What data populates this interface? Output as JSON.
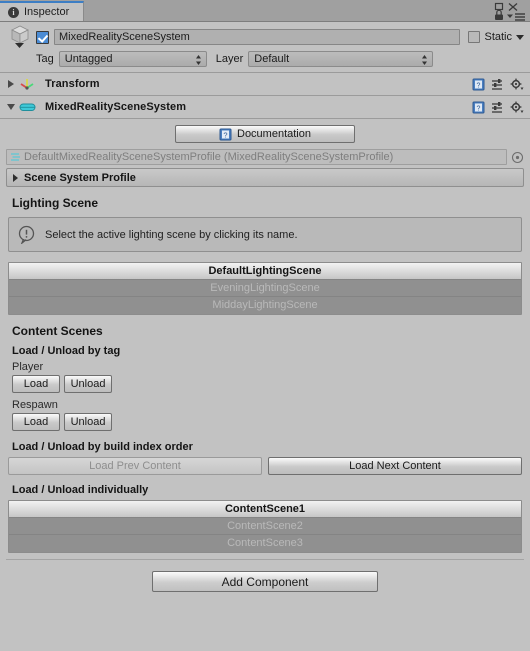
{
  "window": {
    "tab_label": "Inspector",
    "tab_icon": "info-circle-icon",
    "controls": [
      "maximize-icon",
      "close-icon",
      "lock-icon",
      "menu-icon"
    ]
  },
  "gameobject": {
    "icon": "cube-icon",
    "enabled": true,
    "name": "MixedRealitySceneSystem",
    "static_label": "Static",
    "tag_label": "Tag",
    "tag_value": "Untagged",
    "layer_label": "Layer",
    "layer_value": "Default"
  },
  "components": [
    {
      "title": "Transform",
      "icon": "transform-gizmo-icon",
      "expanded": false,
      "tools": [
        "help-book-icon",
        "preset-icon",
        "settings-gear-icon"
      ]
    },
    {
      "title": "MixedRealitySceneSystem",
      "icon": "scene-system-icon",
      "expanded": true,
      "tools": [
        "help-book-icon",
        "preset-icon",
        "settings-gear-icon"
      ]
    }
  ],
  "documentation_button": {
    "label": "Documentation",
    "icon": "book-help-icon"
  },
  "profile_field": {
    "icon": "scriptable-object-icon",
    "value": "DefaultMixedRealitySceneSystemProfile (MixedRealitySceneSystemProfile)",
    "select_icon": "circle-select-icon"
  },
  "scene_system_profile_foldout": {
    "label": "Scene System Profile",
    "expanded": false
  },
  "lighting_scene": {
    "section_title": "Lighting Scene",
    "help": {
      "icon": "info-bubble-icon",
      "text": "Select the active lighting scene by clicking its name."
    },
    "scenes": [
      {
        "name": "DefaultLightingScene",
        "active": true
      },
      {
        "name": "EveningLightingScene",
        "active": false
      },
      {
        "name": "MiddayLightingScene",
        "active": false
      }
    ]
  },
  "content_scenes": {
    "section_title": "Content Scenes",
    "by_tag": {
      "label": "Load / Unload by tag",
      "groups": [
        {
          "tag": "Player",
          "load_label": "Load",
          "unload_label": "Unload"
        },
        {
          "tag": "Respawn",
          "load_label": "Load",
          "unload_label": "Unload"
        }
      ]
    },
    "by_build_index": {
      "label": "Load / Unload by build index order",
      "prev_label": "Load Prev Content",
      "prev_disabled": true,
      "next_label": "Load Next Content",
      "next_disabled": false
    },
    "individually": {
      "label": "Load / Unload individually",
      "scenes": [
        {
          "name": "ContentScene1",
          "active": true
        },
        {
          "name": "ContentScene2",
          "active": false
        },
        {
          "name": "ContentScene3",
          "active": false
        }
      ]
    }
  },
  "add_component_button": {
    "label": "Add Component"
  },
  "colors": {
    "background": "#c2c2c2",
    "tab_accent": "#3d7ec4",
    "checkbox_blue": "#4a8bd4",
    "inactive_row": "#909090"
  }
}
